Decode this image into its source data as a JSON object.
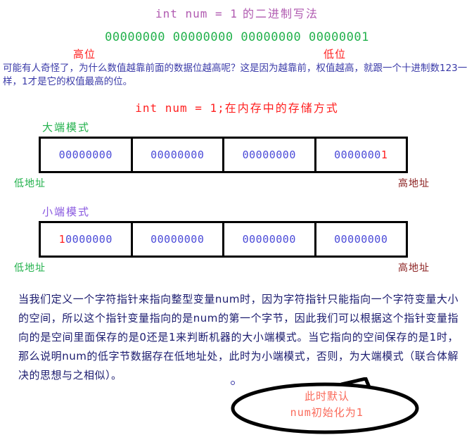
{
  "section_binary": {
    "title_code": "int num = 1",
    "title_cjk": " 的二进制写法",
    "bits": "00000000 00000000 00000000 00000001",
    "high_bit_label": "高位",
    "low_bit_label": "低位",
    "paragraph": "可能有人奇怪了，为什么数值越靠前面的数据位越高呢？这是因为越靠前，权值越高，就跟一个十进制数123一样，1才是它的权值最高的位。"
  },
  "section_memory": {
    "title_code": "int num = 1;",
    "title_cjk": "在内存中的存储方式",
    "big_endian": {
      "mode_label": "大端模式",
      "cells": [
        {
          "zeros": "00000000",
          "hot": ""
        },
        {
          "zeros": "00000000",
          "hot": ""
        },
        {
          "zeros": "00000000",
          "hot": ""
        },
        {
          "zeros": "0000000",
          "hot": "1"
        }
      ],
      "low_address_label": "低地址",
      "high_address_label": "高地址"
    },
    "little_endian": {
      "mode_label": "小端模式",
      "cells": [
        {
          "zeros": "",
          "hot": "1",
          "tail": "0000000"
        },
        {
          "zeros": "00000000",
          "hot": ""
        },
        {
          "zeros": "00000000",
          "hot": ""
        },
        {
          "zeros": "00000000",
          "hot": ""
        }
      ],
      "low_address_label": "低地址",
      "high_address_label": "高地址"
    }
  },
  "explanation": {
    "paragraph": "当我们定义一个字符指针来指向整型变量num时，因为字符指针只能指向一个字符变量大小的空间，所以这个指针变量指向的是num的第一个字节，因此我们可以根据这个指针变量指向的是空间里面保存的是0还是1来判断机器的大小端模式。当它指向的空间保存的是1时，那么说明num的低字节数据存在低地址处，此时为小端模式，否则，为大端模式（联合体解决的思想与之相似）。"
  },
  "callout": {
    "line1": "此时默认",
    "line2_prefix": "num",
    "line2_suffix": "初始化为1"
  },
  "colors": {
    "title_purple": "#b05ab0",
    "bits_green": "#22b14c",
    "red": "#ff2020",
    "blue_text": "#3a3aa8",
    "navy_text": "#1a1a6e",
    "binary_blue": "#4a4ad8",
    "violet": "#8a5ae0",
    "dark_red": "#8b2020",
    "callout_salmon": "#fa6a5a",
    "border_black": "#000000"
  }
}
